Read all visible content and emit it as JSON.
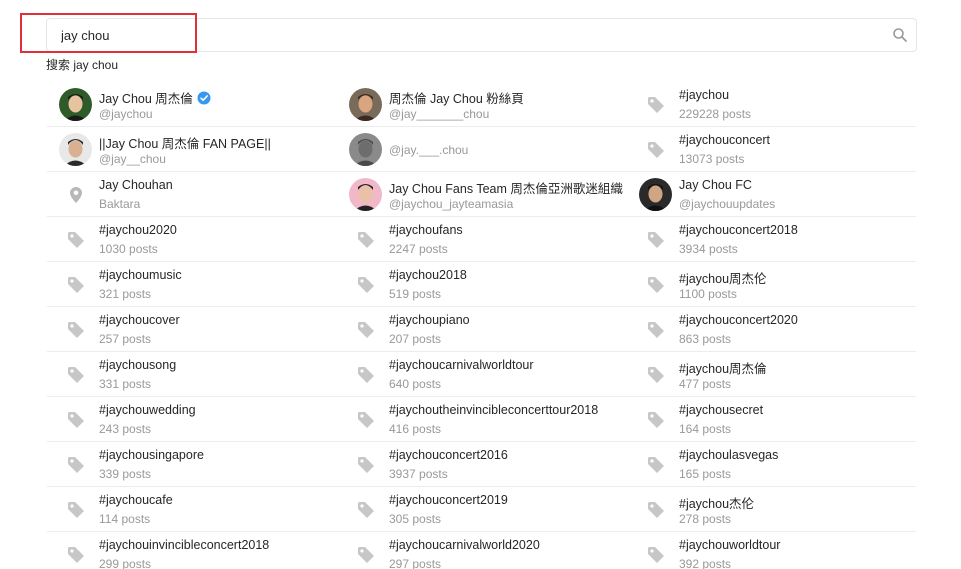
{
  "search": {
    "value": "jay chou",
    "hint": "搜索 jay chou"
  },
  "results": [
    {
      "kind": "user",
      "title": "Jay Chou 周杰倫",
      "sub": "@jaychou",
      "verified": true,
      "avatar": "green-portrait"
    },
    {
      "kind": "user",
      "title": "周杰倫 Jay Chou 粉絲頁",
      "sub": "@jay_______chou",
      "verified": false,
      "avatar": "dark-portrait"
    },
    {
      "kind": "hashtag",
      "title": "#jaychou",
      "sub": "229228 posts"
    },
    {
      "kind": "user",
      "title": "||Jay Chou 周杰倫 FAN PAGE||",
      "sub": "@jay__chou",
      "verified": false,
      "avatar": "light-portrait"
    },
    {
      "kind": "user",
      "title": "",
      "sub": "@jay.___.chou",
      "verified": false,
      "avatar": "grey-portrait"
    },
    {
      "kind": "hashtag",
      "title": "#jaychouconcert",
      "sub": "13073 posts"
    },
    {
      "kind": "place",
      "title": "Jay Chouhan",
      "sub": "Baktara"
    },
    {
      "kind": "user",
      "title": "Jay Chou Fans Team 周杰倫亞洲歌迷組織",
      "sub": "@jaychou_jayteamasia",
      "verified": false,
      "avatar": "pink-portrait"
    },
    {
      "kind": "user",
      "title": "Jay Chou FC",
      "sub": "@jaychouupdates",
      "verified": false,
      "avatar": "black-portrait"
    },
    {
      "kind": "hashtag",
      "title": "#jaychou2020",
      "sub": "1030 posts"
    },
    {
      "kind": "hashtag",
      "title": "#jaychoufans",
      "sub": "2247 posts"
    },
    {
      "kind": "hashtag",
      "title": "#jaychouconcert2018",
      "sub": "3934 posts"
    },
    {
      "kind": "hashtag",
      "title": "#jaychoumusic",
      "sub": "321 posts"
    },
    {
      "kind": "hashtag",
      "title": "#jaychou2018",
      "sub": "519 posts"
    },
    {
      "kind": "hashtag",
      "title": "#jaychou周杰伦",
      "sub": "1100 posts"
    },
    {
      "kind": "hashtag",
      "title": "#jaychoucover",
      "sub": "257 posts"
    },
    {
      "kind": "hashtag",
      "title": "#jaychoupiano",
      "sub": "207 posts"
    },
    {
      "kind": "hashtag",
      "title": "#jaychouconcert2020",
      "sub": "863 posts"
    },
    {
      "kind": "hashtag",
      "title": "#jaychousong",
      "sub": "331 posts"
    },
    {
      "kind": "hashtag",
      "title": "#jaychoucarnivalworldtour",
      "sub": "640 posts"
    },
    {
      "kind": "hashtag",
      "title": "#jaychou周杰倫",
      "sub": "477 posts"
    },
    {
      "kind": "hashtag",
      "title": "#jaychouwedding",
      "sub": "243 posts"
    },
    {
      "kind": "hashtag",
      "title": "#jaychoutheinvincibleconcerttour2018",
      "sub": "416 posts"
    },
    {
      "kind": "hashtag",
      "title": "#jaychousecret",
      "sub": "164 posts"
    },
    {
      "kind": "hashtag",
      "title": "#jaychousingapore",
      "sub": "339 posts"
    },
    {
      "kind": "hashtag",
      "title": "#jaychouconcert2016",
      "sub": "3937 posts"
    },
    {
      "kind": "hashtag",
      "title": "#jaychoulasvegas",
      "sub": "165 posts"
    },
    {
      "kind": "hashtag",
      "title": "#jaychoucafe",
      "sub": "114 posts"
    },
    {
      "kind": "hashtag",
      "title": "#jaychouconcert2019",
      "sub": "305 posts"
    },
    {
      "kind": "hashtag",
      "title": "#jaychou杰伦",
      "sub": "278 posts"
    },
    {
      "kind": "hashtag",
      "title": "#jaychouinvincibleconcert2018",
      "sub": "299 posts"
    },
    {
      "kind": "hashtag",
      "title": "#jaychoucarnivalworld2020",
      "sub": "297 posts"
    },
    {
      "kind": "hashtag",
      "title": "#jaychouworldtour",
      "sub": "392 posts"
    }
  ],
  "colors": {
    "highlight": "#e0313b",
    "verified": "#3897f0",
    "icon": "#c7c7c7",
    "subtext": "#999999"
  }
}
